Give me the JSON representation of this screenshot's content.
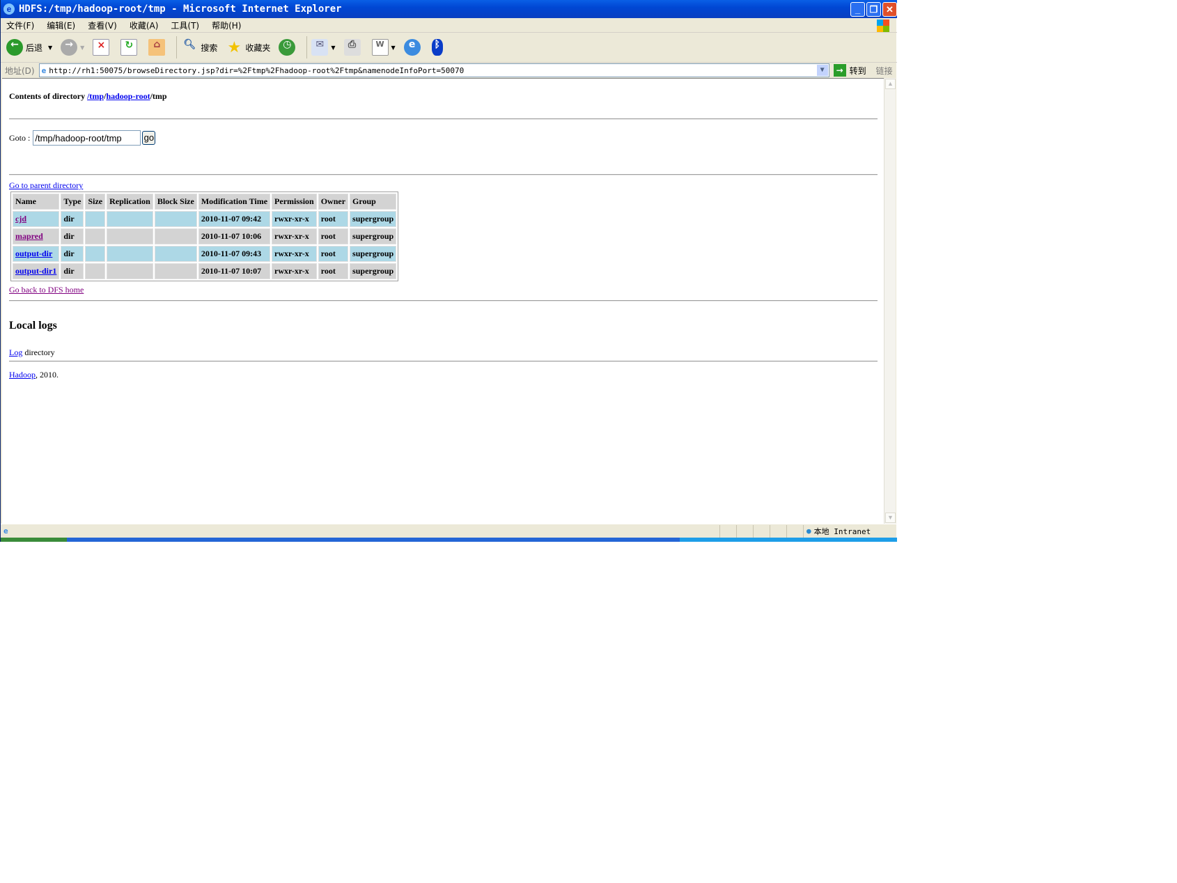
{
  "window": {
    "title": "HDFS:/tmp/hadoop-root/tmp - Microsoft Internet Explorer",
    "minimize": "_",
    "restore": "❐",
    "close": "✕"
  },
  "menu": [
    "文件(F)",
    "编辑(E)",
    "查看(V)",
    "收藏(A)",
    "工具(T)",
    "帮助(H)"
  ],
  "toolbar": {
    "back": "后退",
    "search": "搜索",
    "favorites": "收藏夹"
  },
  "address": {
    "label": "地址(D)",
    "url": "http://rh1:50075/browseDirectory.jsp?dir=%2Ftmp%2Fhadoop-root%2Ftmp&namenodeInfoPort=50070",
    "go": "转到",
    "links": "链接"
  },
  "page": {
    "heading_prefix": "Contents of directory ",
    "crumbs": [
      "/tmp",
      "/",
      "hadoop-root",
      "/tmp"
    ],
    "goto_label": "Goto : ",
    "goto_value": "/tmp/hadoop-root/tmp",
    "go_button": "go",
    "parent_link": "Go to parent directory",
    "columns": [
      "Name",
      "Type",
      "Size",
      "Replication",
      "Block Size",
      "Modification Time",
      "Permission",
      "Owner",
      "Group"
    ],
    "rows": [
      {
        "name": "cjd",
        "type": "dir",
        "size": "",
        "replication": "",
        "block_size": "",
        "mtime": "2010-11-07 09:42",
        "permission": "rwxr-xr-x",
        "owner": "root",
        "group": "supergroup"
      },
      {
        "name": "mapred",
        "type": "dir",
        "size": "",
        "replication": "",
        "block_size": "",
        "mtime": "2010-11-07 10:06",
        "permission": "rwxr-xr-x",
        "owner": "root",
        "group": "supergroup"
      },
      {
        "name": "output-dir",
        "type": "dir",
        "size": "",
        "replication": "",
        "block_size": "",
        "mtime": "2010-11-07 09:43",
        "permission": "rwxr-xr-x",
        "owner": "root",
        "group": "supergroup"
      },
      {
        "name": "output-dir1",
        "type": "dir",
        "size": "",
        "replication": "",
        "block_size": "",
        "mtime": "2010-11-07 10:07",
        "permission": "rwxr-xr-x",
        "owner": "root",
        "group": "supergroup"
      }
    ],
    "dfs_home": "Go back to DFS home",
    "local_logs": "Local logs",
    "log_link": "Log",
    "log_suffix": " directory",
    "hadoop_link": "Hadoop",
    "footer_suffix": ", 2010."
  },
  "status": {
    "zone": "本地 Intranet"
  },
  "colors": {
    "row_alt1": "#add8e6",
    "row_alt2": "#d3d3d3",
    "link": "#0000ee",
    "visited": "#800080"
  }
}
